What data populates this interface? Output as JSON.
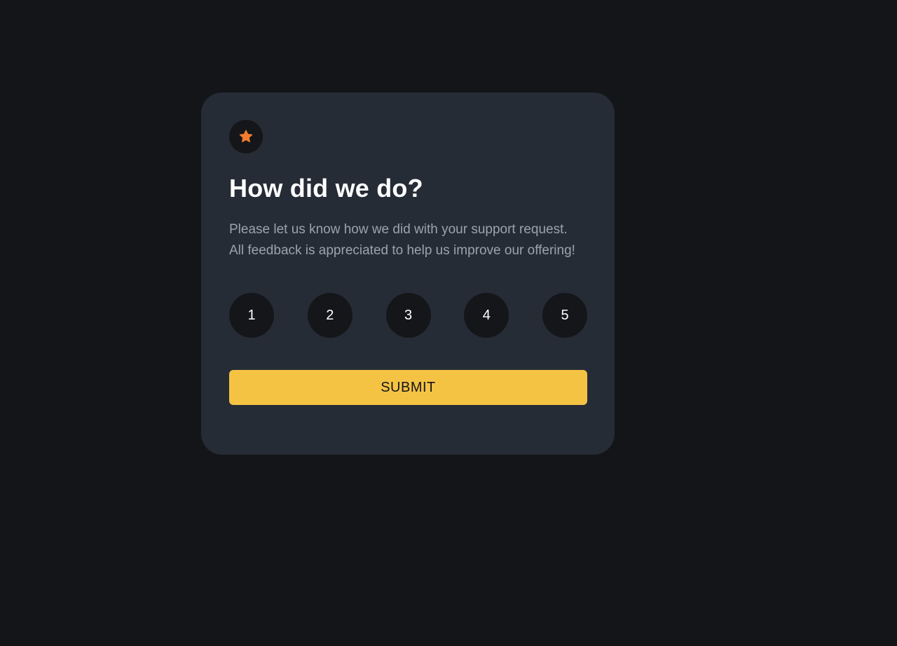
{
  "card": {
    "icon": "star-icon",
    "icon_color": "#f27d2f",
    "title": "How did we do?",
    "description": "Please let us know how we did with your support request. All feedback is appreciated to help us improve our offering!",
    "ratings": [
      "1",
      "2",
      "3",
      "4",
      "5"
    ],
    "submit_label": "SUBMIT"
  },
  "colors": {
    "page_background": "#131518",
    "card_background": "#262c36",
    "circle_background": "#141619",
    "accent": "#f5c344",
    "muted_text": "#9aa3ae"
  }
}
